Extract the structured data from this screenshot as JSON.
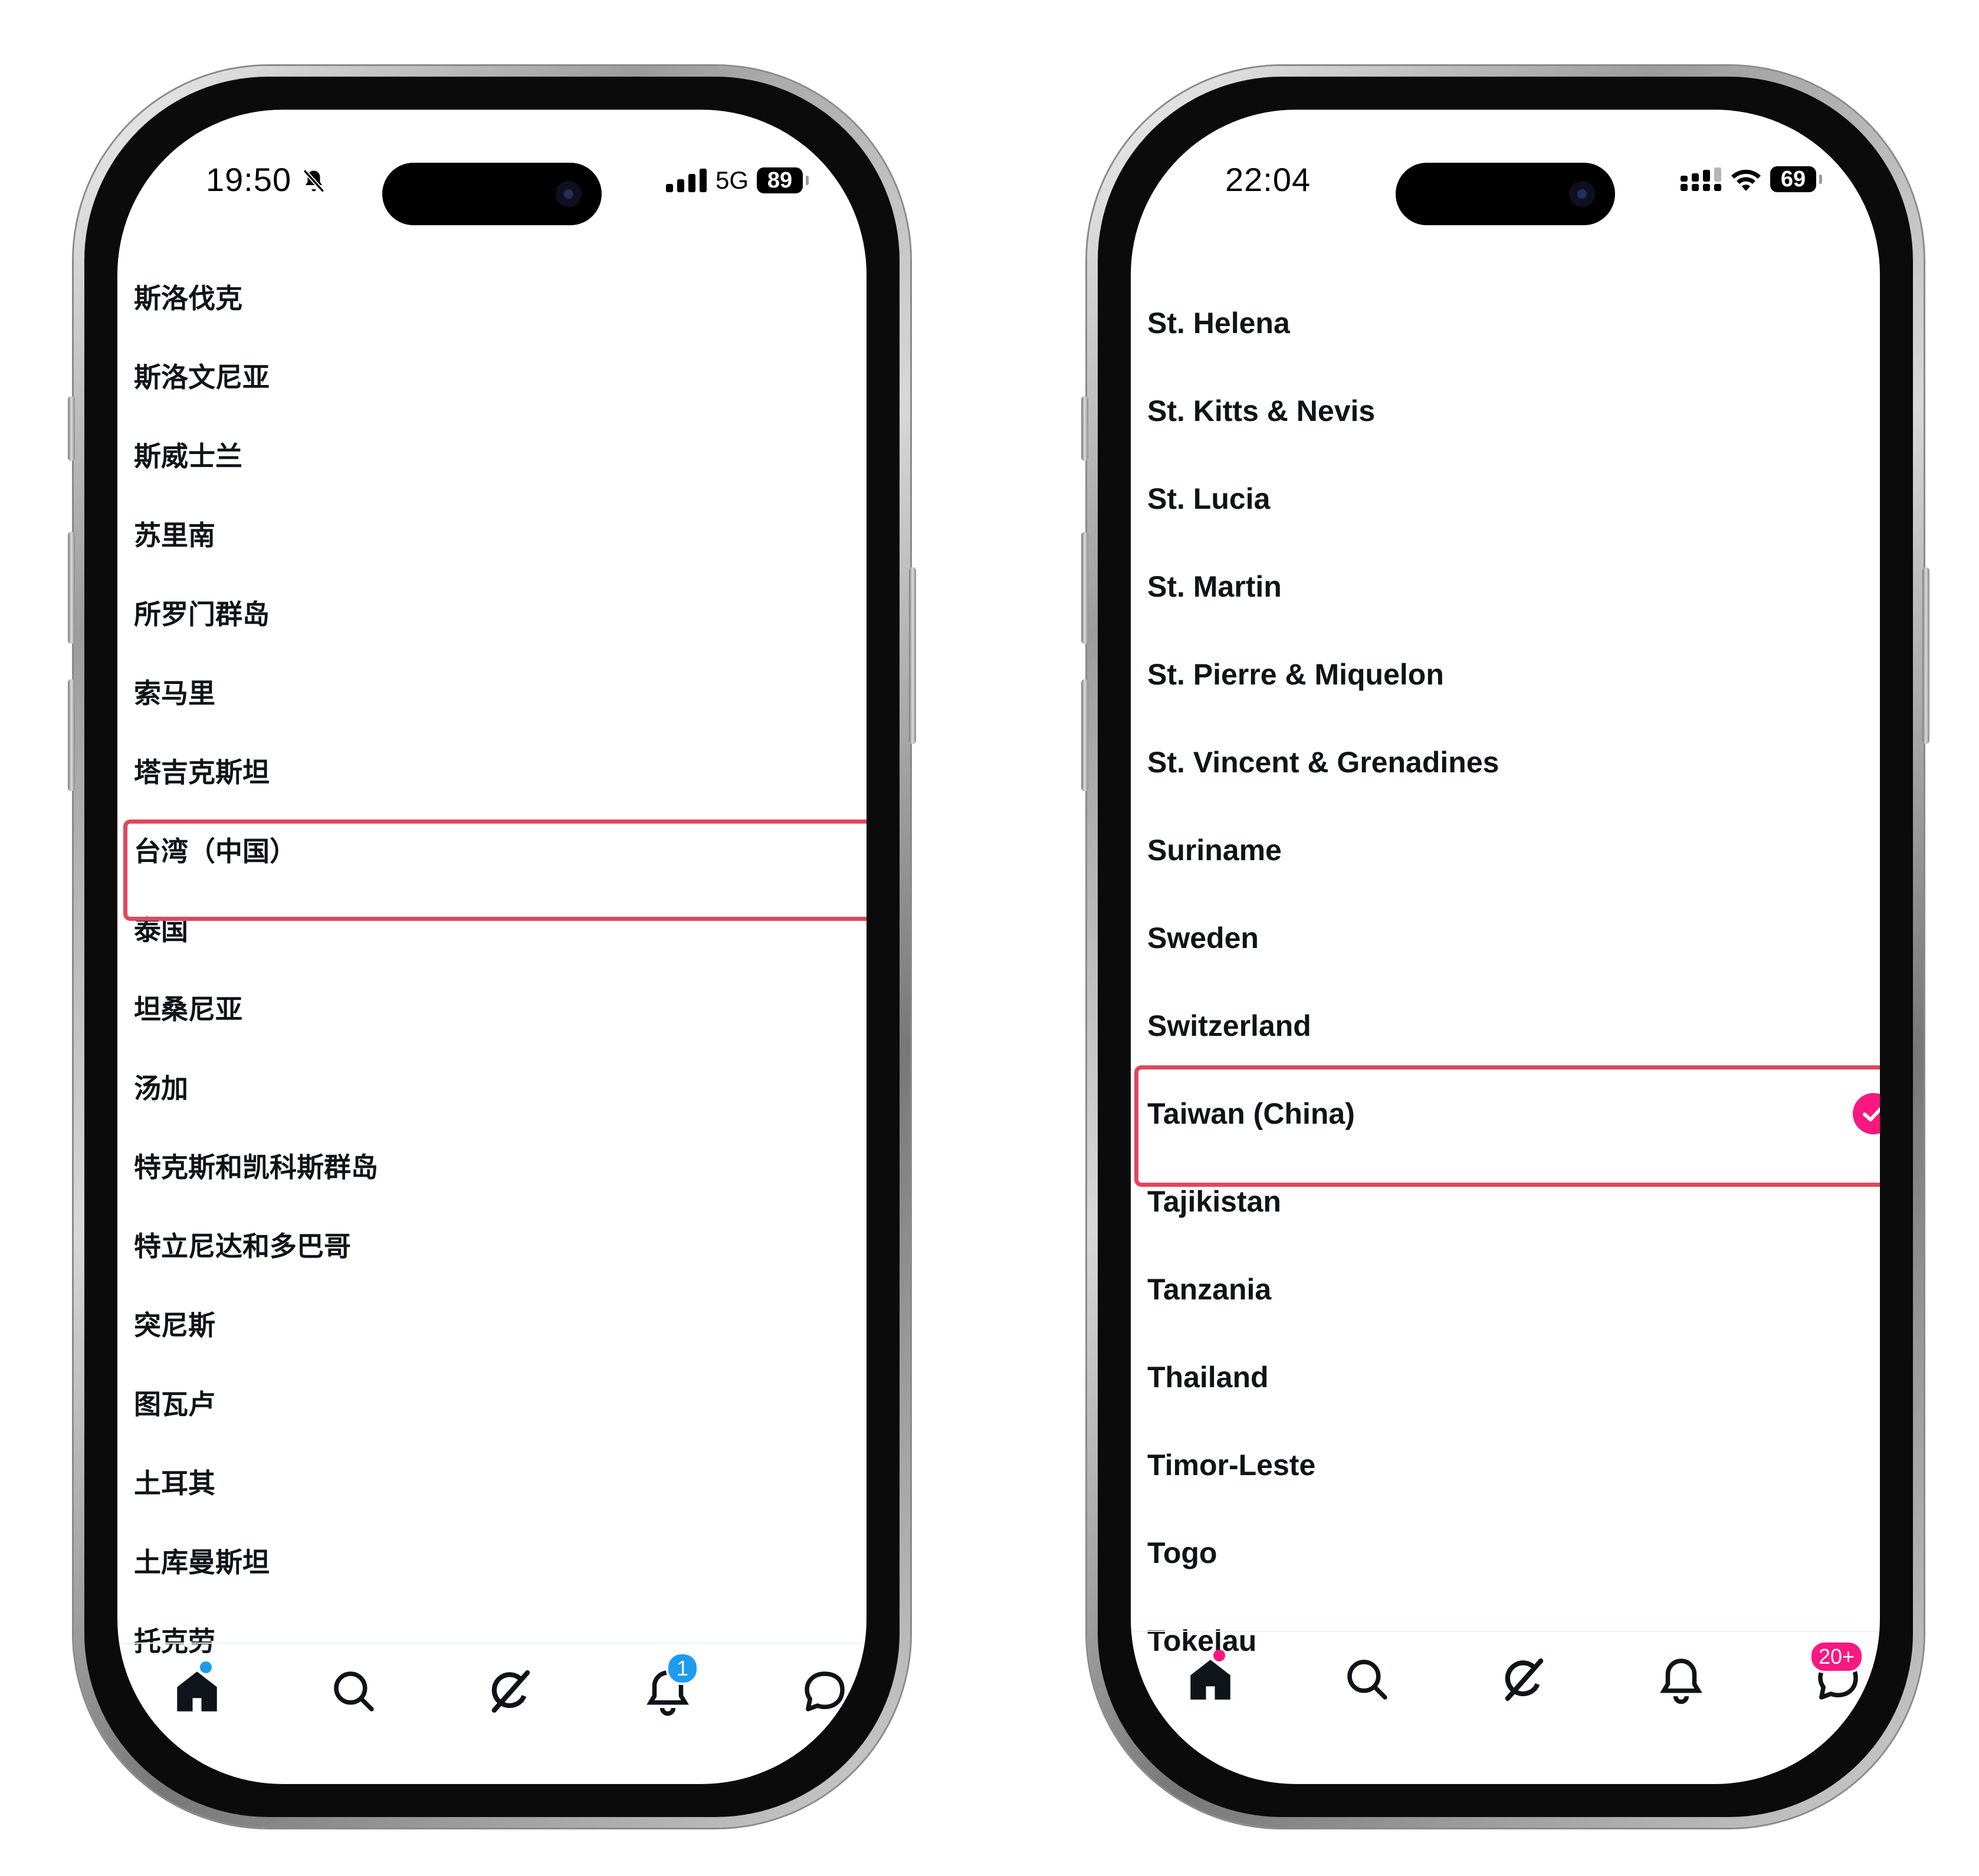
{
  "left": {
    "status": {
      "time": "19:50",
      "network": "5G",
      "battery": "89"
    },
    "countries": [
      "斯洛伐克",
      "斯洛文尼亚",
      "斯威士兰",
      "苏里南",
      "所罗门群岛",
      "索马里",
      "塔吉克斯坦",
      "台湾（中国）",
      "泰国",
      "坦桑尼亚",
      "汤加",
      "特克斯和凯科斯群岛",
      "特立尼达和多巴哥",
      "突尼斯",
      "图瓦卢",
      "土耳其",
      "土库曼斯坦",
      "托克劳"
    ],
    "highlighted_index": 7,
    "notification_badge": "1",
    "accent_color": "#1d9bf0"
  },
  "right": {
    "status": {
      "time": "22:04",
      "battery": "69"
    },
    "countries": [
      "St. Helena",
      "St. Kitts & Nevis",
      "St. Lucia",
      "St. Martin",
      "St. Pierre & Miquelon",
      "St. Vincent & Grenadines",
      "Suriname",
      "Sweden",
      "Switzerland",
      "Taiwan (China)",
      "Tajikistan",
      "Tanzania",
      "Thailand",
      "Timor-Leste",
      "Togo",
      "Tokelau"
    ],
    "selected_index": 9,
    "messages_badge": "20+",
    "accent_color": "#f91880"
  },
  "colors": {
    "highlight_border": "#e0475d",
    "text": "#0f1419",
    "tab_divider": "#eff3f4"
  }
}
